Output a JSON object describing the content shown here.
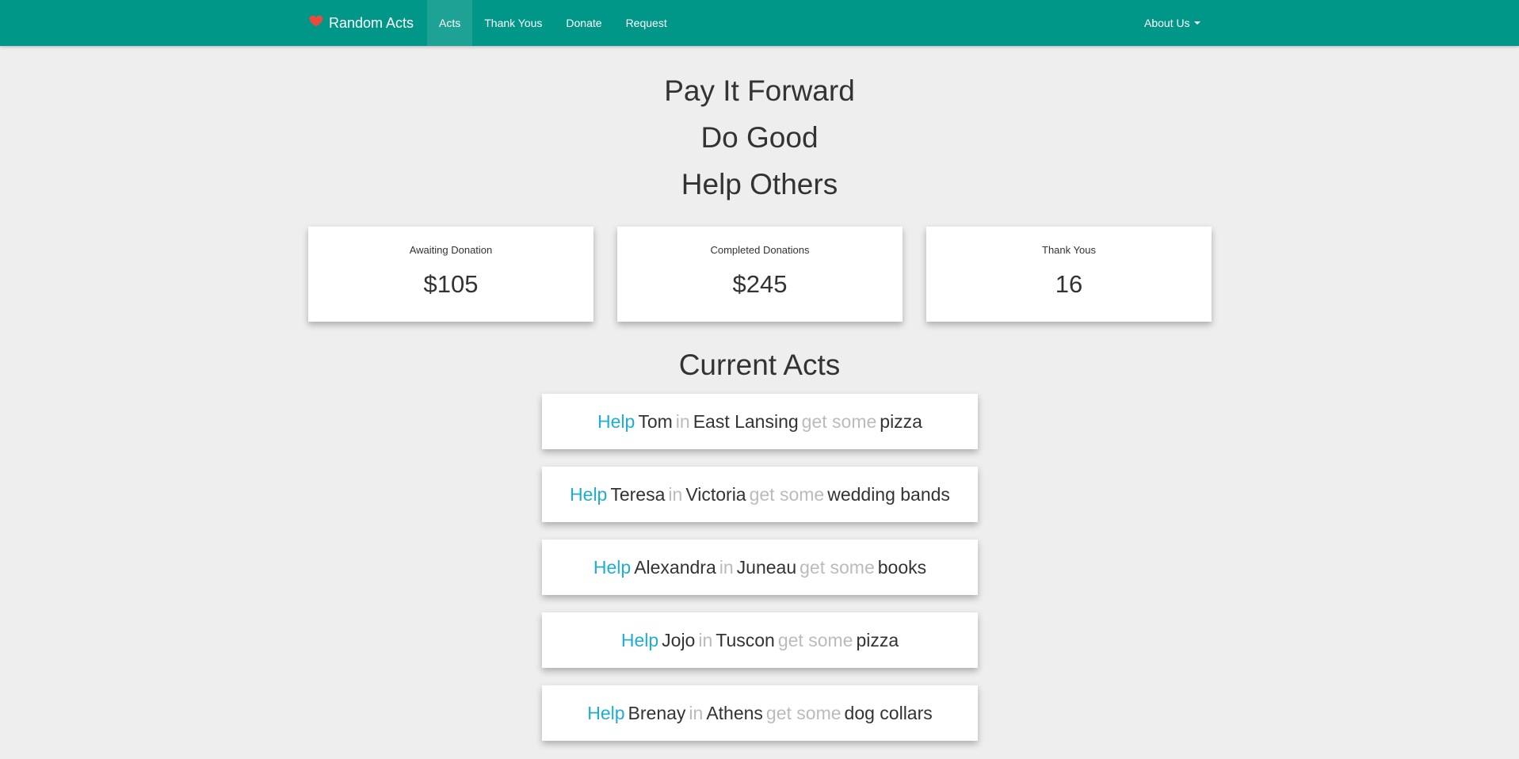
{
  "navbar": {
    "brand": "Random Acts",
    "brand_icon": "heart-icon",
    "links": [
      {
        "label": "Acts",
        "active": true
      },
      {
        "label": "Thank Yous",
        "active": false
      },
      {
        "label": "Donate",
        "active": false
      },
      {
        "label": "Request",
        "active": false
      }
    ],
    "about_label": "About Us",
    "bg_color": "#009688",
    "heart_color": "#e74c3c"
  },
  "hero": {
    "line1": "Pay It Forward",
    "line2": "Do Good",
    "line3": "Help Others"
  },
  "stats": [
    {
      "label": "Awaiting Donation",
      "value": "$105"
    },
    {
      "label": "Completed Donations",
      "value": "$245"
    },
    {
      "label": "Thank Yous",
      "value": "16"
    }
  ],
  "acts_section": {
    "title": "Current Acts",
    "words": {
      "help": "Help",
      "in": "in",
      "get_some": "get some"
    },
    "accent_color": "#1faecd",
    "muted_color": "#bbbbbb",
    "items": [
      {
        "name": "Tom",
        "city": "East Lansing",
        "item": "pizza"
      },
      {
        "name": "Teresa",
        "city": "Victoria",
        "item": "wedding bands"
      },
      {
        "name": "Alexandra",
        "city": "Juneau",
        "item": "books"
      },
      {
        "name": "Jojo",
        "city": "Tuscon",
        "item": "pizza"
      },
      {
        "name": "Brenay",
        "city": "Athens",
        "item": "dog collars"
      }
    ]
  }
}
